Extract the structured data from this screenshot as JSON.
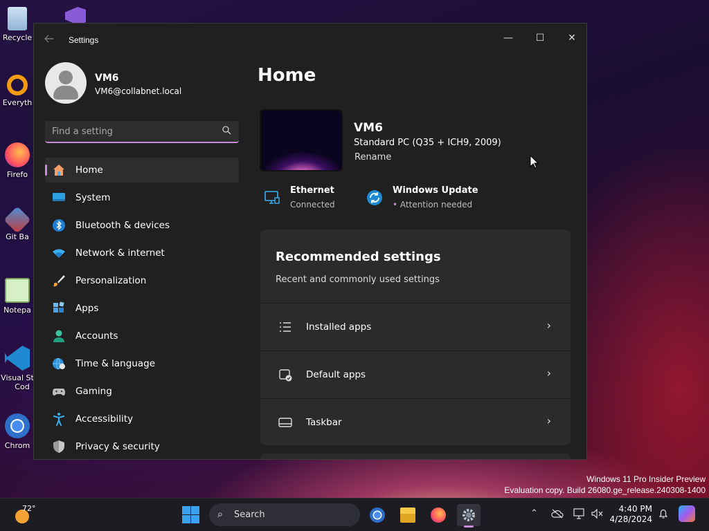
{
  "desktop": {
    "icons": [
      {
        "label": "Recycle"
      },
      {
        "label": "Everyth"
      },
      {
        "label": "Firefo"
      },
      {
        "label": "Git Ba"
      },
      {
        "label": "Notepa"
      },
      {
        "label": "Visual St"
      },
      {
        "label": "Cod"
      },
      {
        "label": "Chrom"
      }
    ]
  },
  "window": {
    "title": "Settings",
    "minimize": "—",
    "maximize": "☐",
    "close": "✕"
  },
  "profile": {
    "name": "VM6",
    "email": "VM6@collabnet.local"
  },
  "search": {
    "placeholder": "Find a setting"
  },
  "nav": [
    {
      "label": "Home",
      "icon": "home-icon",
      "active": true
    },
    {
      "label": "System",
      "icon": "system-icon"
    },
    {
      "label": "Bluetooth & devices",
      "icon": "bluetooth-icon"
    },
    {
      "label": "Network & internet",
      "icon": "wifi-icon"
    },
    {
      "label": "Personalization",
      "icon": "brush-icon"
    },
    {
      "label": "Apps",
      "icon": "apps-icon"
    },
    {
      "label": "Accounts",
      "icon": "accounts-icon"
    },
    {
      "label": "Time & language",
      "icon": "globe-clock-icon"
    },
    {
      "label": "Gaming",
      "icon": "gamepad-icon"
    },
    {
      "label": "Accessibility",
      "icon": "accessibility-icon"
    },
    {
      "label": "Privacy & security",
      "icon": "shield-icon"
    }
  ],
  "main": {
    "heading": "Home",
    "device": {
      "name": "VM6",
      "model": "Standard PC (Q35 + ICH9, 2009)",
      "rename": "Rename"
    },
    "status": [
      {
        "title": "Ethernet",
        "subtitle": "Connected"
      },
      {
        "title": "Windows Update",
        "subtitle": "Attention needed"
      }
    ],
    "recommended": {
      "title": "Recommended settings",
      "subtitle": "Recent and commonly used settings",
      "rows": [
        {
          "label": "Installed apps"
        },
        {
          "label": "Default apps"
        },
        {
          "label": "Taskbar"
        }
      ]
    }
  },
  "watermark": {
    "line1": "Windows 11 Pro Insider Preview",
    "line2": "Evaluation copy. Build 26080.ge_release.240308-1400"
  },
  "taskbar": {
    "weather_temp": "72°",
    "search_label": "Search",
    "clock_time": "4:40 PM",
    "clock_date": "4/28/2024"
  },
  "colors": {
    "accent": "#c98cd6",
    "window_bg": "#202020",
    "card_bg": "#2b2b2b"
  }
}
